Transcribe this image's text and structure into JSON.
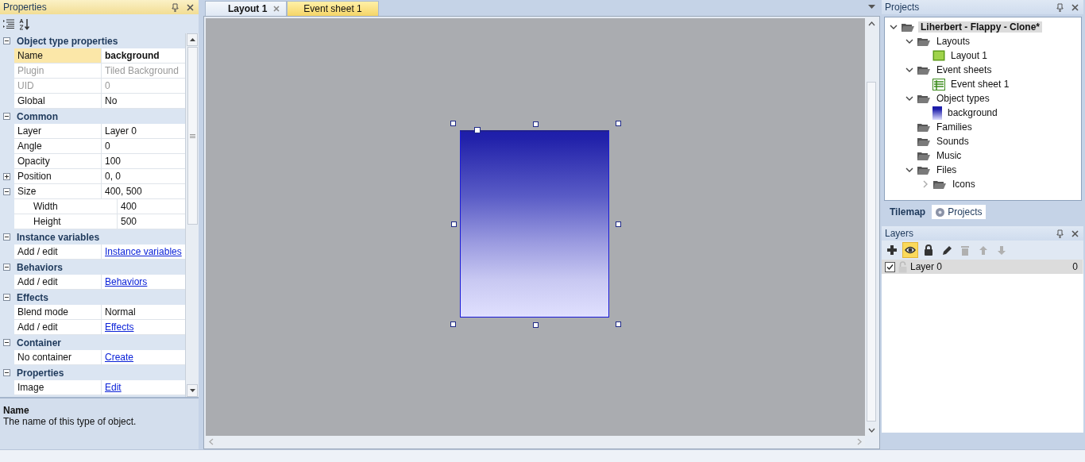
{
  "properties_panel": {
    "title": "Properties",
    "toolbar": [
      {
        "kind": "categorized"
      },
      {
        "kind": "alphabetical"
      }
    ],
    "categories": [
      {
        "label": "Object type properties",
        "expanded": true,
        "rows": [
          {
            "name": "Name",
            "value": "background",
            "kind": "text",
            "selected": true,
            "disabled": false
          },
          {
            "name": "Plugin",
            "value": "Tiled Background",
            "kind": "text",
            "selected": false,
            "disabled": true
          },
          {
            "name": "UID",
            "value": "0",
            "kind": "text",
            "selected": false,
            "disabled": true
          },
          {
            "name": "Global",
            "value": "No",
            "kind": "text",
            "selected": false,
            "disabled": false
          }
        ]
      },
      {
        "label": "Common",
        "expanded": true,
        "rows": [
          {
            "name": "Layer",
            "value": "Layer 0",
            "kind": "text",
            "selected": false,
            "disabled": false
          },
          {
            "name": "Angle",
            "value": "0",
            "kind": "text",
            "selected": false,
            "disabled": false
          },
          {
            "name": "Opacity",
            "value": "100",
            "kind": "text",
            "selected": false,
            "disabled": false
          },
          {
            "name": "Position",
            "value": "0, 0",
            "kind": "text",
            "selected": false,
            "disabled": false,
            "expanded": false
          },
          {
            "name": "Size",
            "value": "400, 500",
            "kind": "text",
            "selected": false,
            "disabled": false,
            "expanded": true,
            "children": [
              {
                "name": "Width",
                "value": "400",
                "kind": "text",
                "selected": false,
                "disabled": false
              },
              {
                "name": "Height",
                "value": "500",
                "kind": "text",
                "selected": false,
                "disabled": false
              }
            ]
          }
        ]
      },
      {
        "label": "Instance variables",
        "expanded": true,
        "rows": [
          {
            "name": "Add / edit",
            "value": "Instance variables",
            "kind": "link",
            "selected": false,
            "disabled": false
          }
        ]
      },
      {
        "label": "Behaviors",
        "expanded": true,
        "rows": [
          {
            "name": "Add / edit",
            "value": "Behaviors",
            "kind": "link",
            "selected": false,
            "disabled": false
          }
        ]
      },
      {
        "label": "Effects",
        "expanded": true,
        "rows": [
          {
            "name": "Blend mode",
            "value": "Normal",
            "kind": "text",
            "selected": false,
            "disabled": false
          },
          {
            "name": "Add / edit",
            "value": "Effects",
            "kind": "link",
            "selected": false,
            "disabled": false
          }
        ]
      },
      {
        "label": "Container",
        "expanded": true,
        "rows": [
          {
            "name": "No container",
            "value": "Create",
            "kind": "link",
            "selected": false,
            "disabled": false
          }
        ]
      },
      {
        "label": "Properties",
        "expanded": true,
        "rows": [
          {
            "name": "Image",
            "value": "Edit",
            "kind": "link",
            "selected": false,
            "disabled": false
          }
        ]
      }
    ],
    "description": {
      "title": "Name",
      "text": "The name of this type of object."
    }
  },
  "editor_tabs": [
    {
      "label": "Layout 1",
      "selected": true
    },
    {
      "label": "Event sheet 1",
      "selected": false
    }
  ],
  "projects_panel": {
    "title": "Projects",
    "tree": [
      {
        "label": "Liherbert - Flappy - Clone*",
        "kind": "project",
        "expanded": true,
        "selected": true,
        "children": [
          {
            "label": "Layouts",
            "kind": "folder",
            "expanded": true,
            "selected": false,
            "children": [
              {
                "label": "Layout 1",
                "kind": "layout",
                "selected": false
              }
            ]
          },
          {
            "label": "Event sheets",
            "kind": "folder",
            "expanded": true,
            "selected": false,
            "children": [
              {
                "label": "Event sheet 1",
                "kind": "eventsheet",
                "selected": false
              }
            ]
          },
          {
            "label": "Object types",
            "kind": "folder",
            "expanded": true,
            "selected": false,
            "children": [
              {
                "label": "background",
                "kind": "object",
                "selected": false
              }
            ]
          },
          {
            "label": "Families",
            "kind": "folder",
            "selected": false
          },
          {
            "label": "Sounds",
            "kind": "folder",
            "selected": false
          },
          {
            "label": "Music",
            "kind": "folder",
            "selected": false
          },
          {
            "label": "Files",
            "kind": "folder",
            "expanded": true,
            "selected": false,
            "children": [
              {
                "label": "Icons",
                "kind": "folder",
                "expanded": false,
                "selected": false
              }
            ]
          }
        ]
      }
    ],
    "tabs": [
      {
        "label": "Tilemap",
        "selected": false
      },
      {
        "label": "Projects",
        "selected": true
      }
    ]
  },
  "layers_panel": {
    "title": "Layers",
    "toolbar": [
      {
        "kind": "add",
        "selected": false,
        "disabled": false
      },
      {
        "kind": "visible",
        "selected": true,
        "disabled": false
      },
      {
        "kind": "lock",
        "selected": false,
        "disabled": false
      },
      {
        "kind": "edit",
        "selected": false,
        "disabled": false
      },
      {
        "kind": "delete",
        "selected": false,
        "disabled": true
      },
      {
        "kind": "up",
        "selected": false,
        "disabled": true
      },
      {
        "kind": "down",
        "selected": false,
        "disabled": true
      }
    ],
    "layers": [
      {
        "name": "Layer 0",
        "value": "0",
        "checked": true,
        "locked": false,
        "selected": true
      }
    ]
  }
}
